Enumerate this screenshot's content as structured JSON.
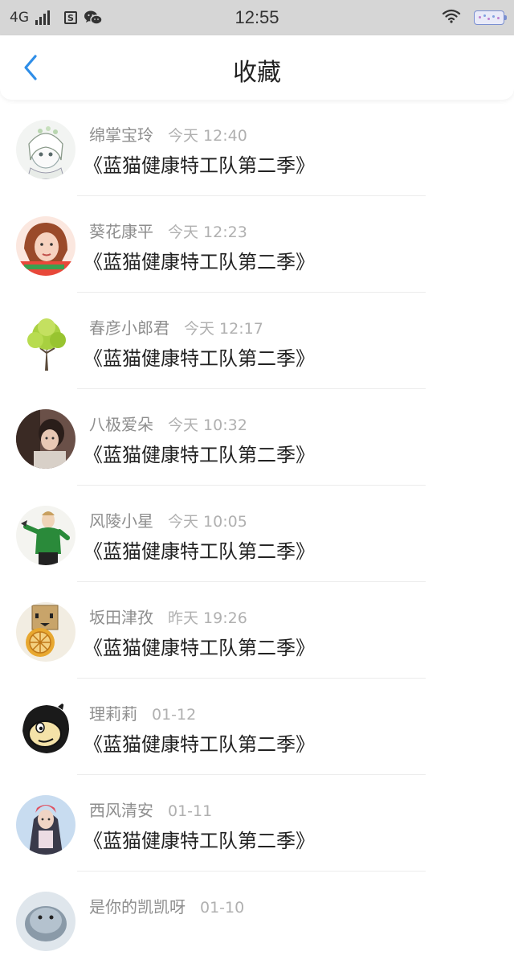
{
  "status_bar": {
    "network": "4G",
    "time": "12:55",
    "s_icon": "S",
    "icons": [
      "signal-icon",
      "s-app-icon",
      "wechat-icon",
      "wifi-icon",
      "battery-icon"
    ]
  },
  "header": {
    "title": "收藏",
    "back_icon": "chevron-left-icon",
    "accent_color": "#2f8ee8"
  },
  "items": [
    {
      "name": "绵掌宝玲",
      "time": "今天 12:40",
      "title": "《蓝猫健康特工队第二季》"
    },
    {
      "name": "葵花康平",
      "time": "今天 12:23",
      "title": "《蓝猫健康特工队第二季》"
    },
    {
      "name": "春彦小郎君",
      "time": "今天 12:17",
      "title": "《蓝猫健康特工队第二季》"
    },
    {
      "name": "八极爱朵",
      "time": "今天 10:32",
      "title": "《蓝猫健康特工队第二季》"
    },
    {
      "name": "风陵小星",
      "time": "今天 10:05",
      "title": "《蓝猫健康特工队第二季》"
    },
    {
      "name": "坂田津孜",
      "time": "昨天 19:26",
      "title": "《蓝猫健康特工队第二季》"
    },
    {
      "name": "理莉莉",
      "time": "01-12",
      "title": "《蓝猫健康特工队第二季》"
    },
    {
      "name": "西风清安",
      "time": "01-11",
      "title": "《蓝猫健康特工队第二季》"
    },
    {
      "name": "是你的凯凯呀",
      "time": "01-10",
      "title": ""
    }
  ]
}
